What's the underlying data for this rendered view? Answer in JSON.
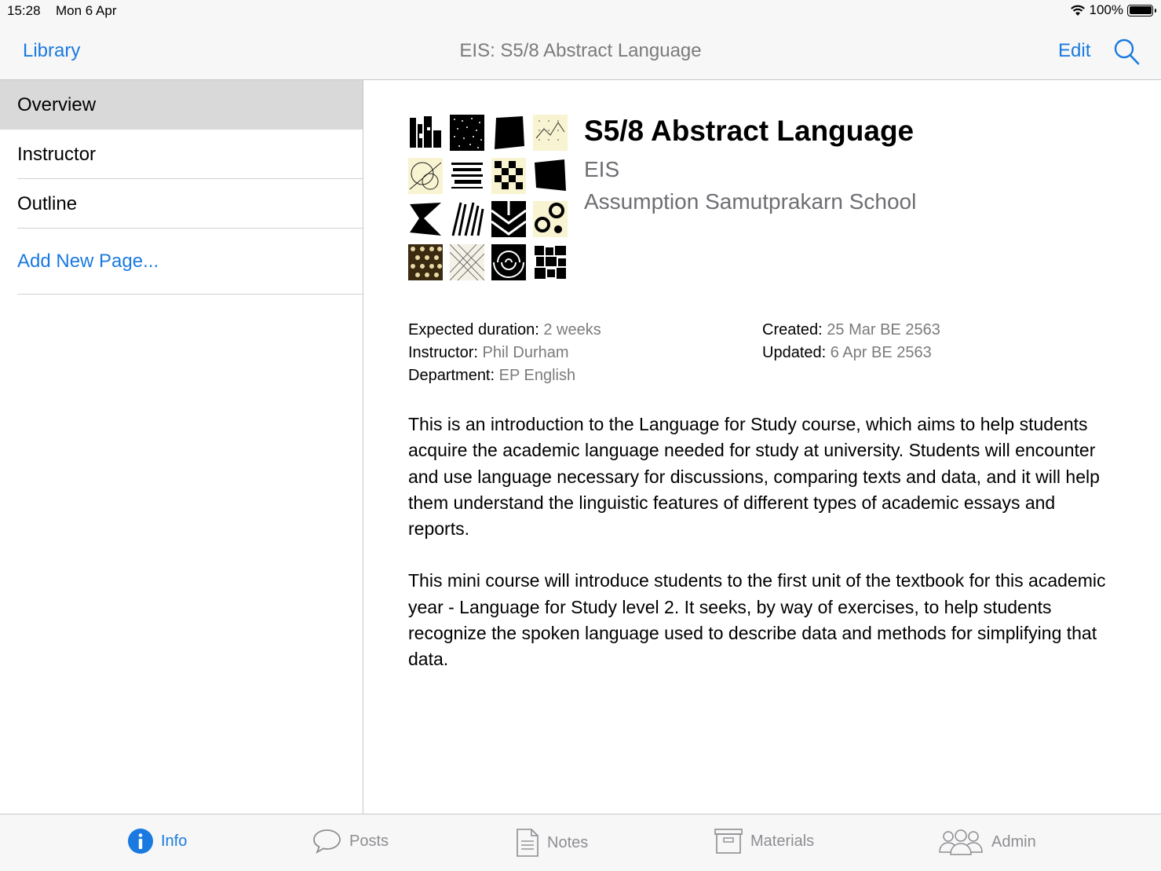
{
  "status_bar": {
    "time": "15:28",
    "date": "Mon 6 Apr",
    "battery": "100%",
    "wifi_icon": "wifi-icon",
    "battery_icon": "battery-icon"
  },
  "nav": {
    "back_label": "Library",
    "title": "EIS: S5/8 Abstract Language",
    "edit_label": "Edit",
    "search_icon": "search-icon"
  },
  "sidebar": {
    "items": [
      {
        "label": "Overview",
        "selected": true
      },
      {
        "label": "Instructor",
        "selected": false
      },
      {
        "label": "Outline",
        "selected": false
      }
    ],
    "add_label": "Add New Page..."
  },
  "course": {
    "title": "S5/8 Abstract Language",
    "code": "EIS",
    "school": "Assumption Samutprakarn School",
    "meta": {
      "duration_label": "Expected duration:",
      "duration": "2 weeks",
      "instructor_label": "Instructor:",
      "instructor": "Phil Durham",
      "department_label": "Department:",
      "department": "EP English",
      "created_label": "Created:",
      "created": "25 Mar BE 2563",
      "updated_label": "Updated:",
      "updated": "6 Apr BE 2563"
    },
    "description": [
      "This is an introduction to the Language for Study course, which aims to help students acquire the academic language needed for study at university. Students will encounter and use language necessary for discussions, comparing texts and data, and it will help them understand the linguistic features of different types of academic essays and reports.",
      "This mini course will introduce students to the first unit of the textbook for this academic year - Language for Study level 2. It seeks, by way of exercises, to help students recognize the spoken language used to describe data and methods for simplifying that data."
    ]
  },
  "tabs": [
    {
      "label": "Info",
      "icon": "info-icon",
      "active": true
    },
    {
      "label": "Posts",
      "icon": "speech-bubble-icon",
      "active": false
    },
    {
      "label": "Notes",
      "icon": "document-icon",
      "active": false
    },
    {
      "label": "Materials",
      "icon": "archive-box-icon",
      "active": false
    },
    {
      "label": "Admin",
      "icon": "people-group-icon",
      "active": false
    }
  ],
  "colors": {
    "accent": "#1a7ae0",
    "selected_row": "#d9d9d9",
    "secondary_text": "#7b7b7b",
    "bar_background": "#f7f7f7"
  }
}
